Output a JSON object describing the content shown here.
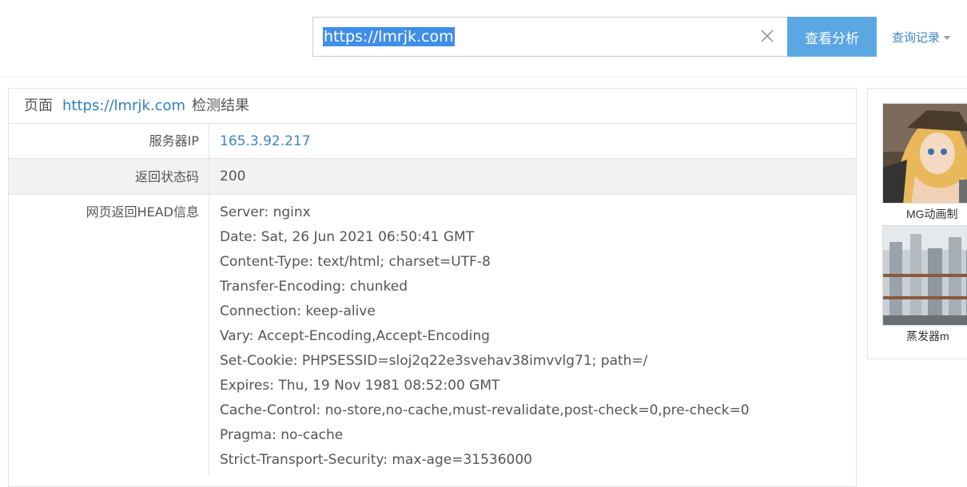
{
  "search": {
    "value": "https://lmrjk.com",
    "button_label": "查看分析",
    "history_label": "查询记录"
  },
  "result": {
    "header_prefix": "页面",
    "header_url": "https://lmrjk.com",
    "header_suffix": "检测结果",
    "rows": {
      "ip": {
        "label": "服务器IP",
        "value": "165.3.92.217"
      },
      "status": {
        "label": "返回状态码",
        "value": "200"
      },
      "head": {
        "label": "网页返回HEAD信息",
        "lines": [
          "Server: nginx",
          "Date: Sat, 26 Jun 2021 06:50:41 GMT",
          "Content-Type: text/html; charset=UTF-8",
          "Transfer-Encoding: chunked",
          "Connection: keep-alive",
          "Vary: Accept-Encoding,Accept-Encoding",
          "Set-Cookie: PHPSESSID=sloj2q22e3svehav38imvvlg71; path=/",
          "Expires: Thu, 19 Nov 1981 08:52:00 GMT",
          "Cache-Control: no-store,no-cache,must-revalidate,post-check=0,pre-check=0",
          "Pragma: no-cache",
          "Strict-Transport-Security: max-age=31536000"
        ]
      }
    }
  },
  "ads": [
    {
      "caption": "MG动画制"
    },
    {
      "caption": "蒸发器m"
    }
  ],
  "colors": {
    "accent_button": "#5ba7e4",
    "link": "#3a86c8",
    "url": "#2f7dc4"
  }
}
